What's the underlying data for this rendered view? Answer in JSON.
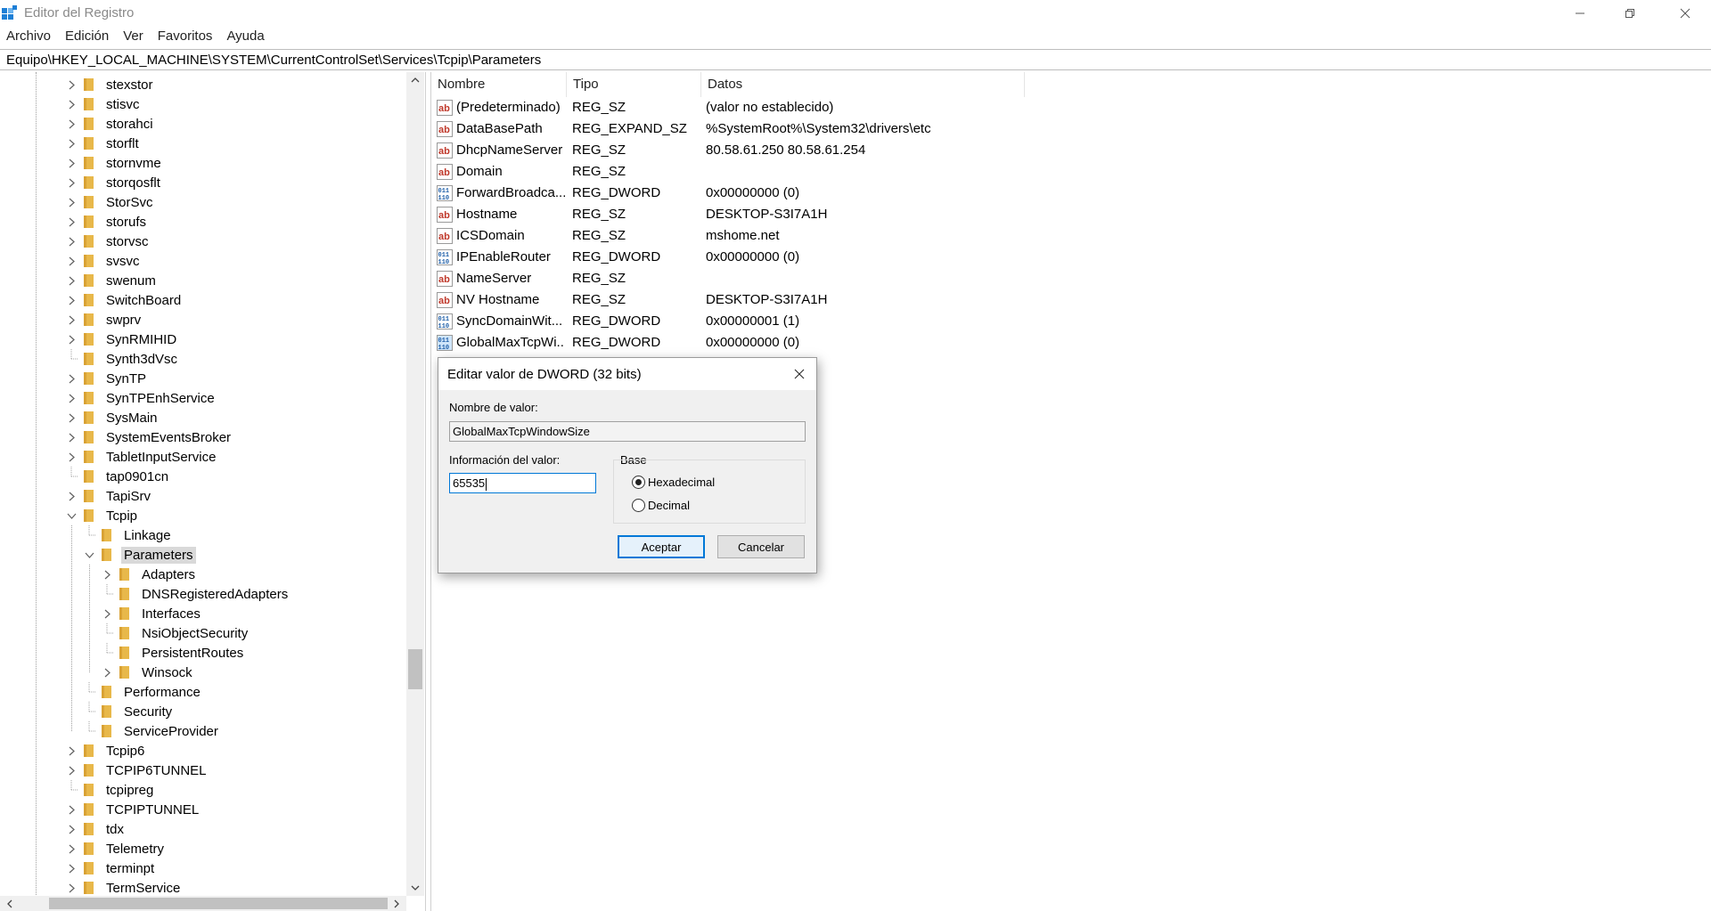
{
  "window": {
    "title": "Editor del Registro",
    "icon": "registry-editor-icon"
  },
  "menu": [
    "Archivo",
    "Edición",
    "Ver",
    "Favoritos",
    "Ayuda"
  ],
  "address": "Equipo\\HKEY_LOCAL_MACHINE\\SYSTEM\\CurrentControlSet\\Services\\Tcpip\\Parameters",
  "tree": {
    "items": [
      {
        "label": "stexstor",
        "level": 0,
        "expander": "collapsed"
      },
      {
        "label": "stisvc",
        "level": 0,
        "expander": "collapsed"
      },
      {
        "label": "storahci",
        "level": 0,
        "expander": "collapsed"
      },
      {
        "label": "storflt",
        "level": 0,
        "expander": "collapsed"
      },
      {
        "label": "stornvme",
        "level": 0,
        "expander": "collapsed"
      },
      {
        "label": "storqosflt",
        "level": 0,
        "expander": "collapsed"
      },
      {
        "label": "StorSvc",
        "level": 0,
        "expander": "collapsed"
      },
      {
        "label": "storufs",
        "level": 0,
        "expander": "collapsed"
      },
      {
        "label": "storvsc",
        "level": 0,
        "expander": "collapsed"
      },
      {
        "label": "svsvc",
        "level": 0,
        "expander": "collapsed"
      },
      {
        "label": "swenum",
        "level": 0,
        "expander": "collapsed"
      },
      {
        "label": "SwitchBoard",
        "level": 0,
        "expander": "collapsed"
      },
      {
        "label": "swprv",
        "level": 0,
        "expander": "collapsed"
      },
      {
        "label": "SynRMIHID",
        "level": 0,
        "expander": "collapsed"
      },
      {
        "label": "Synth3dVsc",
        "level": 0,
        "expander": "none"
      },
      {
        "label": "SynTP",
        "level": 0,
        "expander": "collapsed"
      },
      {
        "label": "SynTPEnhService",
        "level": 0,
        "expander": "collapsed"
      },
      {
        "label": "SysMain",
        "level": 0,
        "expander": "collapsed"
      },
      {
        "label": "SystemEventsBroker",
        "level": 0,
        "expander": "collapsed"
      },
      {
        "label": "TabletInputService",
        "level": 0,
        "expander": "collapsed"
      },
      {
        "label": "tap0901cn",
        "level": 0,
        "expander": "none"
      },
      {
        "label": "TapiSrv",
        "level": 0,
        "expander": "collapsed"
      },
      {
        "label": "Tcpip",
        "level": 0,
        "expander": "expanded"
      },
      {
        "label": "Linkage",
        "level": 1,
        "expander": "none"
      },
      {
        "label": "Parameters",
        "level": 1,
        "expander": "expanded",
        "selected": true
      },
      {
        "label": "Adapters",
        "level": 2,
        "expander": "collapsed"
      },
      {
        "label": "DNSRegisteredAdapters",
        "level": 2,
        "expander": "none"
      },
      {
        "label": "Interfaces",
        "level": 2,
        "expander": "collapsed"
      },
      {
        "label": "NsiObjectSecurity",
        "level": 2,
        "expander": "none"
      },
      {
        "label": "PersistentRoutes",
        "level": 2,
        "expander": "none"
      },
      {
        "label": "Winsock",
        "level": 2,
        "expander": "collapsed"
      },
      {
        "label": "Performance",
        "level": 1,
        "expander": "none"
      },
      {
        "label": "Security",
        "level": 1,
        "expander": "none"
      },
      {
        "label": "ServiceProvider",
        "level": 1,
        "expander": "none"
      },
      {
        "label": "Tcpip6",
        "level": 0,
        "expander": "collapsed"
      },
      {
        "label": "TCPIP6TUNNEL",
        "level": 0,
        "expander": "collapsed"
      },
      {
        "label": "tcpipreg",
        "level": 0,
        "expander": "none"
      },
      {
        "label": "TCPIPTUNNEL",
        "level": 0,
        "expander": "collapsed"
      },
      {
        "label": "tdx",
        "level": 0,
        "expander": "collapsed"
      },
      {
        "label": "Telemetry",
        "level": 0,
        "expander": "collapsed"
      },
      {
        "label": "terminpt",
        "level": 0,
        "expander": "collapsed"
      },
      {
        "label": "TermService",
        "level": 0,
        "expander": "collapsed"
      }
    ]
  },
  "list": {
    "columns": [
      "Nombre",
      "Tipo",
      "Datos"
    ],
    "rows": [
      {
        "icon": "string-value-icon",
        "name": "(Predeterminado)",
        "type": "REG_SZ",
        "data": "(valor no establecido)"
      },
      {
        "icon": "string-value-icon",
        "name": "DataBasePath",
        "type": "REG_EXPAND_SZ",
        "data": "%SystemRoot%\\System32\\drivers\\etc"
      },
      {
        "icon": "string-value-icon",
        "name": "DhcpNameServer",
        "type": "REG_SZ",
        "data": "80.58.61.250 80.58.61.254"
      },
      {
        "icon": "string-value-icon",
        "name": "Domain",
        "type": "REG_SZ",
        "data": ""
      },
      {
        "icon": "binary-value-icon",
        "name": "ForwardBroadca...",
        "type": "REG_DWORD",
        "data": "0x00000000 (0)"
      },
      {
        "icon": "string-value-icon",
        "name": "Hostname",
        "type": "REG_SZ",
        "data": "DESKTOP-S3I7A1H"
      },
      {
        "icon": "string-value-icon",
        "name": "ICSDomain",
        "type": "REG_SZ",
        "data": "mshome.net"
      },
      {
        "icon": "binary-value-icon",
        "name": "IPEnableRouter",
        "type": "REG_DWORD",
        "data": "0x00000000 (0)"
      },
      {
        "icon": "string-value-icon",
        "name": "NameServer",
        "type": "REG_SZ",
        "data": ""
      },
      {
        "icon": "string-value-icon",
        "name": "NV Hostname",
        "type": "REG_SZ",
        "data": "DESKTOP-S3I7A1H"
      },
      {
        "icon": "binary-value-icon",
        "name": "SyncDomainWit...",
        "type": "REG_DWORD",
        "data": "0x00000001 (1)"
      },
      {
        "icon": "binary-value-icon",
        "name": "GlobalMaxTcpWi...",
        "type": "REG_DWORD",
        "data": "0x00000000 (0)",
        "selected": true
      }
    ]
  },
  "dialog": {
    "title": "Editar valor de DWORD (32 bits)",
    "value_name_label": "Nombre de valor:",
    "value_name": "GlobalMaxTcpWindowSize",
    "value_data_label": "Información del valor:",
    "value_data": "65535",
    "base_label": "Base",
    "base_options": [
      {
        "label": "Hexadecimal",
        "checked": true
      },
      {
        "label": "Decimal",
        "checked": false
      }
    ],
    "ok_label": "Aceptar",
    "cancel_label": "Cancelar"
  },
  "colors": {
    "folder": "#e8b84a",
    "selection": "#d9d9d9",
    "accent": "#0078d7"
  }
}
